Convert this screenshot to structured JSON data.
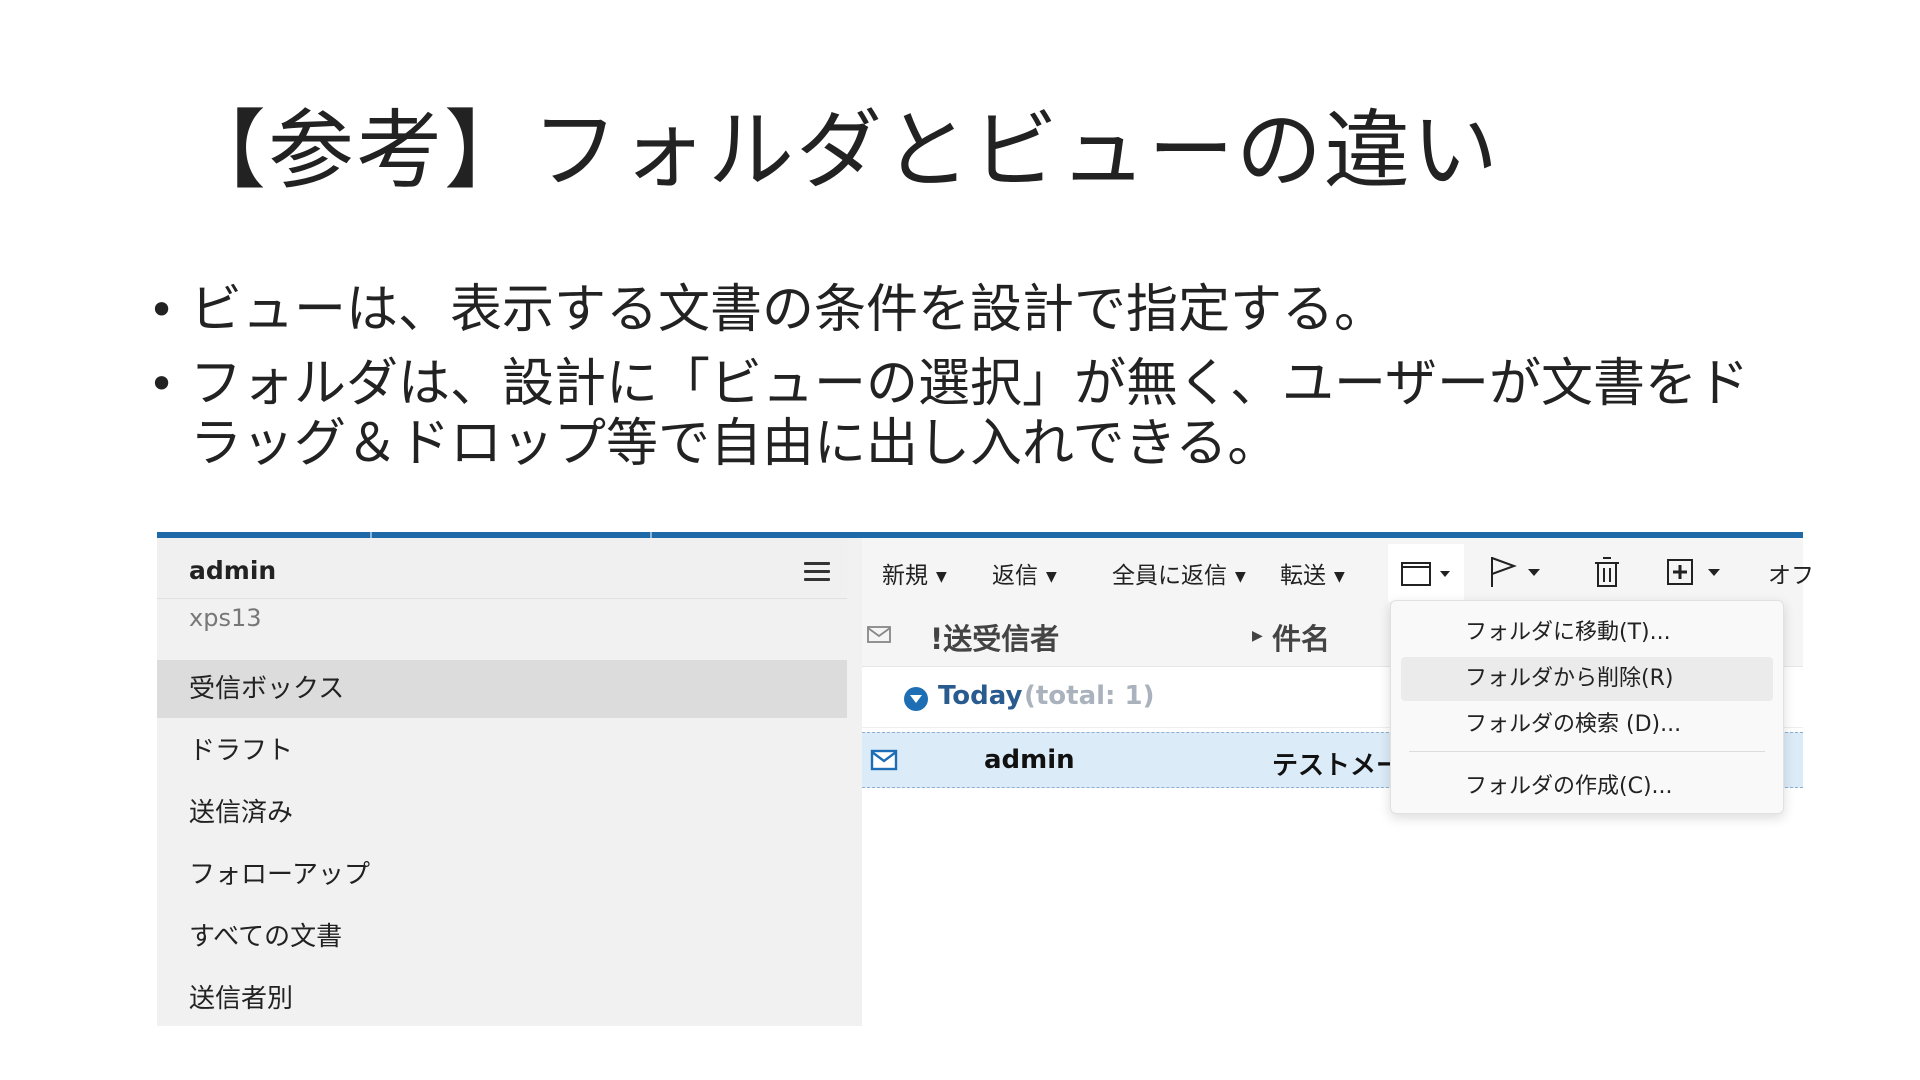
{
  "slide": {
    "title": "【参考】フォルダとビューの違い",
    "bullets": [
      "ビューは、表示する文書の条件を設計で指定する。",
      "フォルダは、設計に「ビューの選択」が無く、ユーザーが文書をドラッグ＆ドロップ等で自由に出し入れできる。"
    ]
  },
  "sidebar": {
    "user": "admin",
    "server": "xps13",
    "items": [
      {
        "label": "受信ボックス"
      },
      {
        "label": "ドラフト"
      },
      {
        "label": "送信済み"
      },
      {
        "label": "フォローアップ"
      },
      {
        "label": "すべての文書"
      },
      {
        "label": "送信者別"
      }
    ]
  },
  "toolbar": {
    "new_label": "新規",
    "reply_label": "返信",
    "reply_all_label": "全員に返信",
    "forward_label": "転送",
    "more_label": "オフ",
    "icons": [
      "folder-icon",
      "flag-icon",
      "trash-icon",
      "add-box-icon"
    ]
  },
  "list": {
    "columns": {
      "from": "!送受信者",
      "subject": "件名"
    },
    "group": {
      "label": "Today",
      "total": "(total: 1)"
    },
    "rows": [
      {
        "from": "admin",
        "subject": "テストメー"
      }
    ]
  },
  "folder_menu": {
    "items": [
      {
        "label": "フォルダに移動(T)..."
      },
      {
        "label": "フォルダから削除(R)"
      },
      {
        "label": "フォルダの検索 (D)..."
      },
      {
        "label": "フォルダの作成(C)..."
      }
    ]
  },
  "colors": {
    "accent": "#1e6aa8",
    "selection": "#dcebf8",
    "group_label": "#2a5b8f"
  }
}
